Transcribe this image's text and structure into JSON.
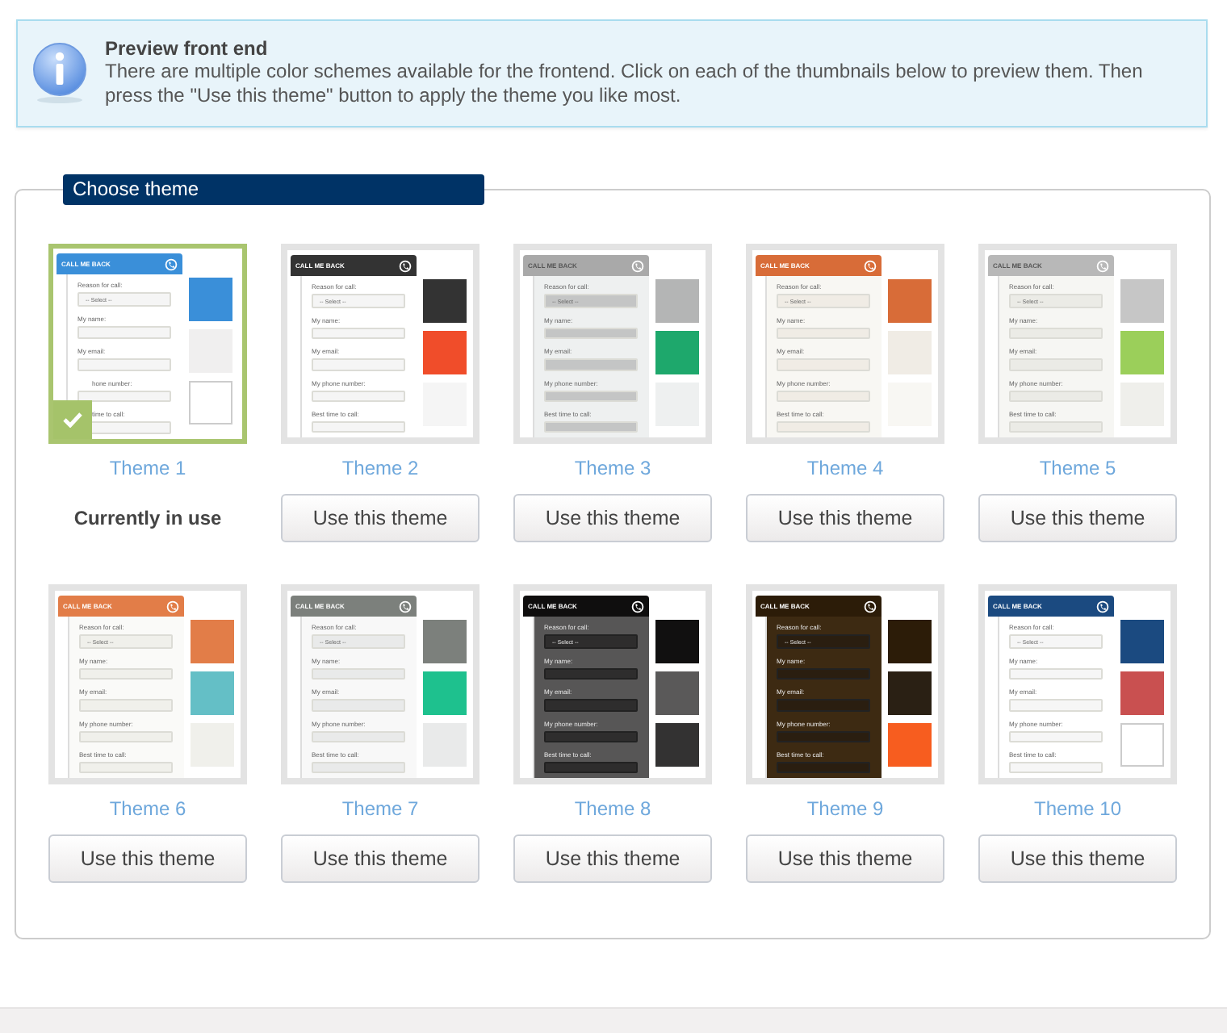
{
  "info": {
    "title": "Preview front end",
    "text": "There are multiple color schemes available for the frontend. Click on each of the thumbnails below to preview them. Then press the \"Use this theme\" button to apply the theme you like most."
  },
  "section": {
    "title": "Choose theme"
  },
  "themes": [
    {
      "label": "Theme 1",
      "selected": true,
      "action": "Currently in use",
      "preview": {
        "title": "CALL ME BACK",
        "select": "-- Select --",
        "labels": [
          "Reason for call:",
          "My name:",
          "My email:",
          "hone number:",
          "time to call:"
        ]
      },
      "header": {
        "color": "#3a8fd9"
      },
      "panel": {
        "color": "#ffffff"
      },
      "field": {
        "color": "#f5f5f5"
      },
      "swatches": [
        {
          "color": "#3a8fd9"
        },
        {
          "color": "#f0efef"
        },
        {
          "color": "#ffffff"
        }
      ]
    },
    {
      "label": "Theme 2",
      "selected": false,
      "action": "Use this theme",
      "preview": {
        "title": "CALL ME BACK",
        "select": "-- Select --",
        "labels": [
          "Reason for call:",
          "My name:",
          "My email:",
          "My phone number:",
          "Best time to call:"
        ]
      },
      "header": {
        "color": "#333333"
      },
      "panel": {
        "color": "#ffffff"
      },
      "field": {
        "color": "#f5f5f5"
      },
      "swatches": [
        {
          "color": "#333333"
        },
        {
          "color": "#f04d2a"
        },
        {
          "color": "#f5f5f5"
        }
      ]
    },
    {
      "label": "Theme 3",
      "selected": false,
      "action": "Use this theme",
      "preview": {
        "title": "CALL ME BACK",
        "select": "-- Select --",
        "labels": [
          "Reason for call:",
          "My name:",
          "My email:",
          "My phone number:",
          "Best time to call:"
        ]
      },
      "header": {
        "color": "#a9a9a9"
      },
      "panel": {
        "color": "#eef0f0"
      },
      "field": {
        "color": "#c4c5c5"
      },
      "swatches": [
        {
          "color": "#b4b5b5"
        },
        {
          "color": "#1ea86c"
        },
        {
          "color": "#eef0f0"
        }
      ]
    },
    {
      "label": "Theme 4",
      "selected": false,
      "action": "Use this theme",
      "preview": {
        "title": "CALL ME BACK",
        "select": "-- Select --",
        "labels": [
          "Reason for call:",
          "My name:",
          "My email:",
          "My phone number:",
          "Best time to call:"
        ]
      },
      "header": {
        "color": "#d86c38"
      },
      "panel": {
        "color": "#f8f7f3"
      },
      "field": {
        "color": "#f0ece5"
      },
      "swatches": [
        {
          "color": "#d86c38"
        },
        {
          "color": "#f0ece5"
        },
        {
          "color": "#f8f7f3"
        }
      ]
    },
    {
      "label": "Theme 5",
      "selected": false,
      "action": "Use this theme",
      "preview": {
        "title": "CALL ME BACK",
        "select": "-- Select --",
        "labels": [
          "Reason for call:",
          "My name:",
          "My email:",
          "My phone number:",
          "Best time to call:"
        ]
      },
      "header": {
        "color": "#b8b8b8"
      },
      "panel": {
        "color": "#f6f6f3"
      },
      "field": {
        "color": "#ebebe6"
      },
      "swatches": [
        {
          "color": "#c6c6c6"
        },
        {
          "color": "#9bcf5a"
        },
        {
          "color": "#efefeb"
        }
      ]
    },
    {
      "label": "Theme 6",
      "selected": false,
      "action": "Use this theme",
      "preview": {
        "title": "CALL ME BACK",
        "select": "-- Select --",
        "labels": [
          "Reason for call:",
          "My name:",
          "My email:",
          "My phone number:",
          "Best time to call:"
        ]
      },
      "header": {
        "color": "#e27d48"
      },
      "panel": {
        "color": "#fafaf8"
      },
      "field": {
        "color": "#f0f0eb"
      },
      "swatches": [
        {
          "color": "#e27d48"
        },
        {
          "color": "#64bfc6"
        },
        {
          "color": "#f0f0eb"
        }
      ]
    },
    {
      "label": "Theme 7",
      "selected": false,
      "action": "Use this theme",
      "preview": {
        "title": "CALL ME BACK",
        "select": "-- Select --",
        "labels": [
          "Reason for call:",
          "My name:",
          "My email:",
          "My phone number:",
          "Best time to call:"
        ]
      },
      "header": {
        "color": "#7c807c"
      },
      "panel": {
        "color": "#f8f8f8"
      },
      "field": {
        "color": "#e9eaea"
      },
      "swatches": [
        {
          "color": "#7c807c"
        },
        {
          "color": "#1ec18e"
        },
        {
          "color": "#e9eaea"
        }
      ]
    },
    {
      "label": "Theme 8",
      "selected": false,
      "action": "Use this theme",
      "preview": {
        "title": "CALL ME BACK",
        "select": "-- Select --",
        "labels": [
          "Reason for call:",
          "My name:",
          "My email:",
          "My phone number:",
          "Best time to call:"
        ]
      },
      "header": {
        "color": "#0f0e0e"
      },
      "panel": {
        "color": "#575656"
      },
      "field": {
        "color": "#2e2d2d"
      },
      "swatches": [
        {
          "color": "#111010"
        },
        {
          "color": "#5a5959"
        },
        {
          "color": "#333232"
        }
      ]
    },
    {
      "label": "Theme 9",
      "selected": false,
      "action": "Use this theme",
      "preview": {
        "title": "CALL ME BACK",
        "select": "-- Select --",
        "labels": [
          "Reason for call:",
          "My name:",
          "My email:",
          "My phone number:",
          "Best time to call:"
        ]
      },
      "header": {
        "color": "#2c1c08"
      },
      "panel": {
        "color": "#3d2a12"
      },
      "field": {
        "color": "#2a1e10"
      },
      "swatches": [
        {
          "color": "#2c1c08"
        },
        {
          "color": "#2a2014"
        },
        {
          "color": "#f75d1f"
        }
      ]
    },
    {
      "label": "Theme 10",
      "selected": false,
      "action": "Use this theme",
      "preview": {
        "title": "CALL ME BACK",
        "select": "-- Select --",
        "labels": [
          "Reason for call:",
          "My name:",
          "My email:",
          "My phone number:",
          "Best time to call:"
        ]
      },
      "header": {
        "color": "#1b4a80"
      },
      "panel": {
        "color": "#ffffff"
      },
      "field": {
        "color": "#f6f6f6"
      },
      "swatches": [
        {
          "color": "#1b4a80"
        },
        {
          "color": "#c95050"
        },
        {
          "color": "#ffffff"
        }
      ]
    }
  ]
}
